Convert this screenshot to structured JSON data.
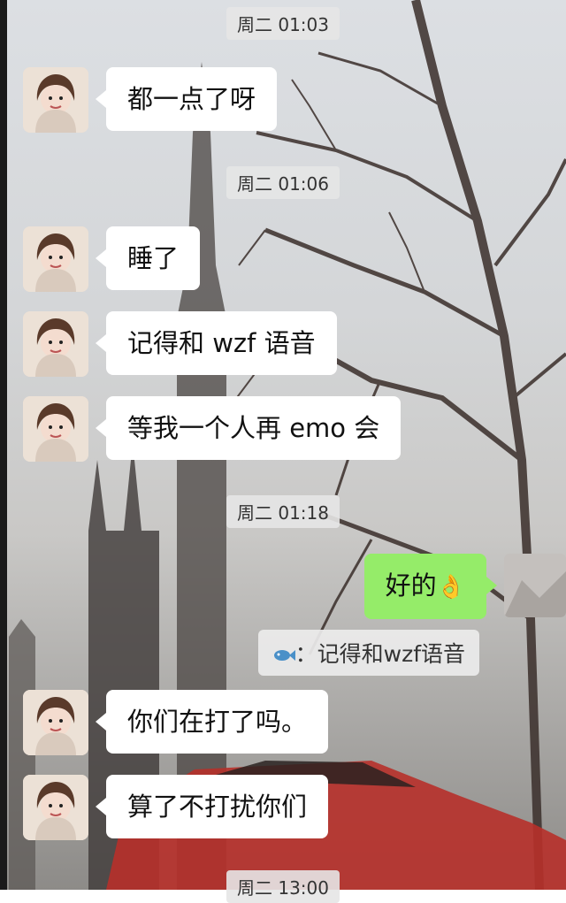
{
  "messages": [
    {
      "type": "time",
      "text": "周二  01:03"
    },
    {
      "type": "in",
      "text": "都一点了呀"
    },
    {
      "type": "time",
      "text": "周二  01:06"
    },
    {
      "type": "in",
      "text": "睡了"
    },
    {
      "type": "in",
      "text": "记得和 wzf 语音"
    },
    {
      "type": "in",
      "text": "等我一个人再 emo 会"
    },
    {
      "type": "time",
      "text": "周二  01:18"
    },
    {
      "type": "out",
      "text": "好的",
      "emoji": "👌"
    },
    {
      "type": "quote",
      "icon": "fish-icon",
      "text": "：记得和wzf语音"
    },
    {
      "type": "in",
      "text": "你们在打了吗。"
    },
    {
      "type": "in",
      "text": "算了不打扰你们"
    },
    {
      "type": "time",
      "text": "周二  13:00"
    }
  ],
  "colors": {
    "outgoing_bubble": "#95ec69",
    "incoming_bubble": "#ffffff",
    "time_chip": "#e6e6e6"
  }
}
